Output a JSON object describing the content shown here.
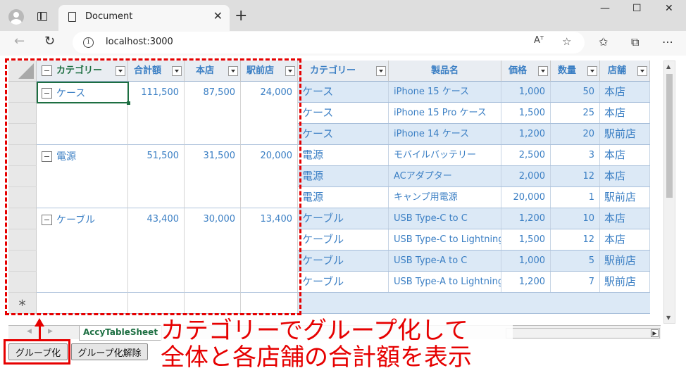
{
  "browser": {
    "tab_title": "Document",
    "url": "localhost:3000",
    "reader_icon": "Aᵀ",
    "window_controls": [
      "—",
      "☐",
      "✕"
    ]
  },
  "sheet": {
    "left_headers": [
      "カテゴリー",
      "合計額",
      "本店",
      "駅前店"
    ],
    "groups": [
      {
        "category": "ケース",
        "total": "111,500",
        "honten": "87,500",
        "ekimae": "24,000"
      },
      {
        "category": "電源",
        "total": "51,500",
        "honten": "31,500",
        "ekimae": "20,000"
      },
      {
        "category": "ケーブル",
        "total": "43,400",
        "honten": "30,000",
        "ekimae": "13,400"
      }
    ],
    "new_row_marker": "*",
    "right_headers": [
      "カテゴリー",
      "製品名",
      "価格",
      "数量",
      "店舗"
    ],
    "rows": [
      [
        "ケース",
        "iPhone 15 ケース",
        "1,000",
        "50",
        "本店"
      ],
      [
        "ケース",
        "iPhone 15 Pro ケース",
        "1,500",
        "25",
        "本店"
      ],
      [
        "ケース",
        "iPhone 14 ケース",
        "1,200",
        "20",
        "駅前店"
      ],
      [
        "電源",
        "モバイルバッテリー",
        "2,500",
        "3",
        "本店"
      ],
      [
        "電源",
        "ACアダプター",
        "2,000",
        "12",
        "本店"
      ],
      [
        "電源",
        "キャンプ用電源",
        "20,000",
        "1",
        "駅前店"
      ],
      [
        "ケーブル",
        "USB Type-C to C",
        "1,200",
        "10",
        "本店"
      ],
      [
        "ケーブル",
        "USB Type-C to Lightning",
        "1,500",
        "12",
        "本店"
      ],
      [
        "ケーブル",
        "USB Type-A to C",
        "1,000",
        "5",
        "駅前店"
      ],
      [
        "ケーブル",
        "USB Type-A to Lightning",
        "1,200",
        "7",
        "駅前店"
      ]
    ],
    "sheet_tab": "AccyTableSheet"
  },
  "buttons": {
    "group": "グループ化",
    "ungroup": "グループ化解除"
  },
  "annotation": {
    "line1": "カテゴリーでグループ化して",
    "line2": "全体と各店舗の合計額を表示"
  },
  "colors": {
    "accent_blue": "#3b7fc4",
    "band_blue": "#dce9f6",
    "annotation_red": "#e60000",
    "selection_green": "#1d6f42"
  }
}
